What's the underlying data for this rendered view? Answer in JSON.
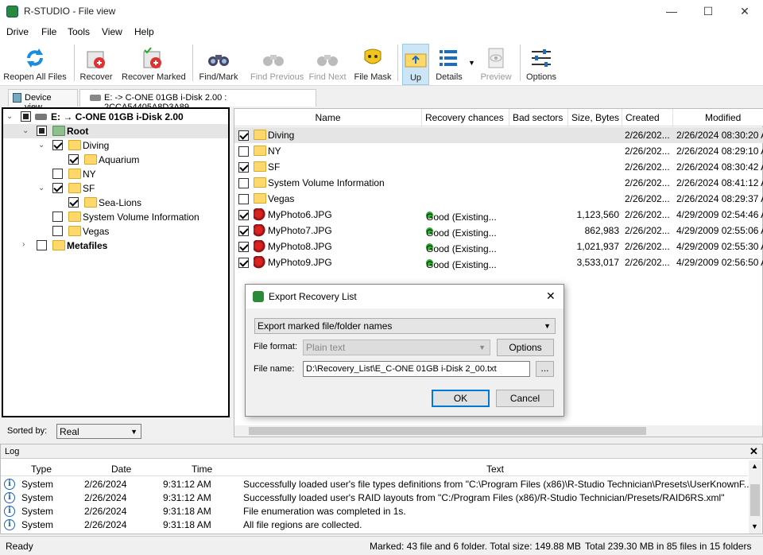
{
  "window": {
    "title": "R-STUDIO - File view",
    "min": "—",
    "max": "☐",
    "close": "✕"
  },
  "menu": [
    "Drive",
    "File",
    "Tools",
    "View",
    "Help"
  ],
  "toolbar": {
    "reopen": "Reopen All Files",
    "recover": "Recover",
    "recover_marked": "Recover Marked",
    "find_mark": "Find/Mark",
    "find_previous": "Find Previous",
    "find_next": "Find Next",
    "file_mask": "File Mask",
    "up": "Up",
    "details": "Details",
    "preview": "Preview",
    "options": "Options"
  },
  "tabs": {
    "device_view": "Device view",
    "current": "E: -> C-ONE 01GB i-Disk 2.00 : 2CCA54405A8D3A89"
  },
  "tree": {
    "drive": "E: → C-ONE 01GB i-Disk 2.00",
    "root": "Root",
    "diving": "Diving",
    "aquarium": "Aquarium",
    "ny": "NY",
    "sf": "SF",
    "sealions": "Sea-Lions",
    "svi": "System Volume Information",
    "vegas": "Vegas",
    "metafiles": "Metafiles"
  },
  "sorted": {
    "label": "Sorted by:",
    "value": "Real"
  },
  "columns": {
    "name": "Name",
    "chances": "Recovery chances",
    "bad": "Bad sectors",
    "size": "Size, Bytes",
    "created": "Created",
    "modified": "Modified"
  },
  "files": [
    {
      "name": "Diving",
      "chance": "",
      "size": "",
      "created": "2/26/202...",
      "modified": "2/26/2024 08:30:20 A",
      "checked": true,
      "type": "folder"
    },
    {
      "name": "NY",
      "chance": "",
      "size": "",
      "created": "2/26/202...",
      "modified": "2/26/2024 08:29:10 A",
      "checked": false,
      "type": "folder"
    },
    {
      "name": "SF",
      "chance": "",
      "size": "",
      "created": "2/26/202...",
      "modified": "2/26/2024 08:30:42 A",
      "checked": true,
      "type": "folder"
    },
    {
      "name": "System Volume Information",
      "chance": "",
      "size": "",
      "created": "2/26/202...",
      "modified": "2/26/2024 08:41:12 A",
      "checked": false,
      "type": "folder"
    },
    {
      "name": "Vegas",
      "chance": "",
      "size": "",
      "created": "2/26/202...",
      "modified": "2/26/2024 08:29:37 A",
      "checked": false,
      "type": "folder"
    },
    {
      "name": "MyPhoto6.JPG",
      "chance": "Good (Existing...",
      "size": "1,123,560",
      "created": "2/26/202...",
      "modified": "4/29/2009 02:54:46 A",
      "checked": true,
      "type": "photo"
    },
    {
      "name": "MyPhoto7.JPG",
      "chance": "Good (Existing...",
      "size": "862,983",
      "created": "2/26/202...",
      "modified": "4/29/2009 02:55:06 A",
      "checked": true,
      "type": "photo"
    },
    {
      "name": "MyPhoto8.JPG",
      "chance": "Good (Existing...",
      "size": "1,021,937",
      "created": "2/26/202...",
      "modified": "4/29/2009 02:55:30 A",
      "checked": true,
      "type": "photo"
    },
    {
      "name": "MyPhoto9.JPG",
      "chance": "Good (Existing...",
      "size": "3,533,017",
      "created": "2/26/202...",
      "modified": "4/29/2009 02:56:50 A",
      "checked": true,
      "type": "photo"
    }
  ],
  "dialog": {
    "title": "Export Recovery List",
    "mode": "Export marked file/folder names",
    "format_label": "File format:",
    "format_value": "Plain text",
    "options": "Options",
    "name_label": "File name:",
    "name_value": "D:\\Recovery_List\\E_C-ONE 01GB i-Disk 2_00.txt",
    "browse": "...",
    "ok": "OK",
    "cancel": "Cancel"
  },
  "log": {
    "title": "Log",
    "columns": {
      "type": "Type",
      "date": "Date",
      "time": "Time",
      "text": "Text"
    },
    "rows": [
      {
        "type": "System",
        "date": "2/26/2024",
        "time": "9:31:12 AM",
        "text": "Successfully loaded user's file types definitions from \"C:\\Program Files (x86)\\R-Studio Technician\\Presets\\UserKnownF..."
      },
      {
        "type": "System",
        "date": "2/26/2024",
        "time": "9:31:12 AM",
        "text": "Successfully loaded user's RAID layouts from \"C:/Program Files (x86)/R-Studio Technician/Presets/RAID6RS.xml\""
      },
      {
        "type": "System",
        "date": "2/26/2024",
        "time": "9:31:18 AM",
        "text": "File enumeration was completed in 1s."
      },
      {
        "type": "System",
        "date": "2/26/2024",
        "time": "9:31:18 AM",
        "text": "All file regions are collected."
      }
    ]
  },
  "status": {
    "ready": "Ready",
    "marked": "Marked: 43 file and 6 folder. Total size: 149.88 MB",
    "total": "Total 239.30 MB in 85 files in 15 folders"
  }
}
